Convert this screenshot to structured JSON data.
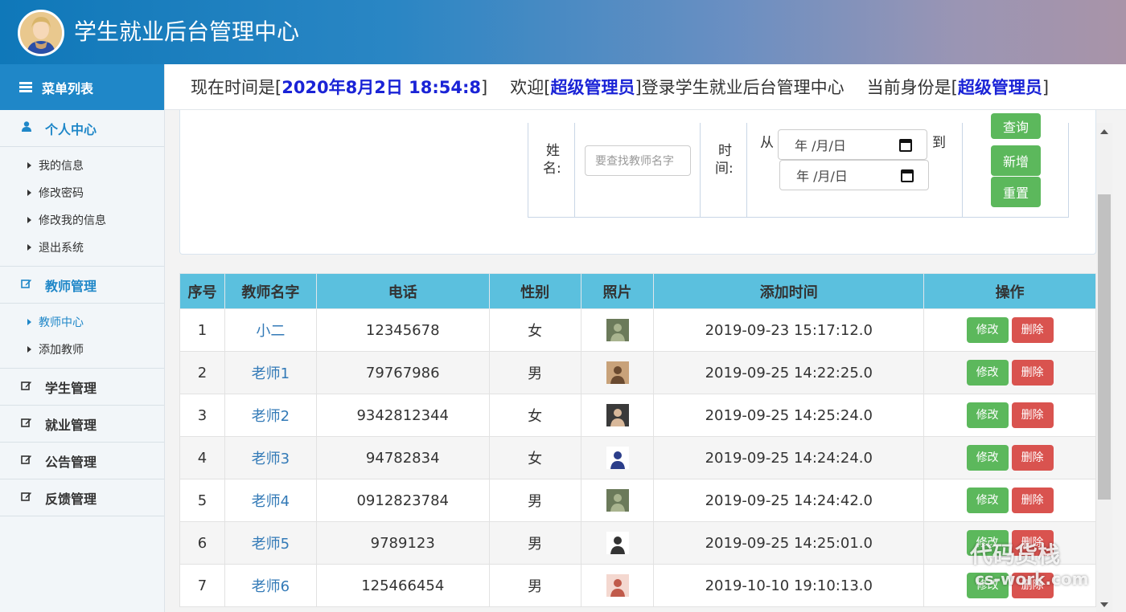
{
  "header": {
    "title": "学生就业后台管理中心"
  },
  "sidebar": {
    "menu_title": "菜单列表",
    "groups": [
      {
        "title": "个人中心",
        "icon": "user-icon",
        "items": [
          "我的信息",
          "修改密码",
          "修改我的信息",
          "退出系统"
        ]
      },
      {
        "title": "教师管理",
        "icon": "edit-icon",
        "items": [
          "教师中心",
          "添加教师"
        ]
      },
      {
        "title": "学生管理",
        "icon": "edit-icon"
      },
      {
        "title": "就业管理",
        "icon": "edit-icon"
      },
      {
        "title": "公告管理",
        "icon": "edit-icon"
      },
      {
        "title": "反馈管理",
        "icon": "edit-icon"
      }
    ]
  },
  "infobar": {
    "time_prefix": "现在时间是[",
    "time_value": "2020年8月2日 18:54:8",
    "time_suffix": "]",
    "welcome_prefix": "欢迎[",
    "welcome_user": "超级管理员",
    "welcome_suffix": "]登录学生就业后台管理中心",
    "role_prefix": "当前身份是[",
    "role_value": "超级管理员",
    "role_suffix": "]"
  },
  "search": {
    "name_label_1": "姓",
    "name_label_2": "名:",
    "name_placeholder": "要查找教师名字",
    "time_label_1": "时",
    "time_label_2": "间:",
    "from_label": "从",
    "to_label": "到",
    "date_placeholder": "年 /月/日",
    "query_button": "查询",
    "add_button": "新增",
    "reset_button": "重置"
  },
  "table": {
    "columns": [
      "序号",
      "教师名字",
      "电话",
      "性别",
      "照片",
      "添加时间",
      "操作"
    ],
    "edit_label": "修改",
    "delete_label": "删除",
    "rows": [
      [
        "1",
        "小二",
        "12345678",
        "女",
        "2019-09-23 15:17:12.0"
      ],
      [
        "2",
        "老师1",
        "79767986",
        "男",
        "2019-09-25 14:22:25.0"
      ],
      [
        "3",
        "老师2",
        "9342812344",
        "女",
        "2019-09-25 14:25:24.0"
      ],
      [
        "4",
        "老师3",
        "94782834",
        "女",
        "2019-09-25 14:24:24.0"
      ],
      [
        "5",
        "老师4",
        "0912823784",
        "男",
        "2019-09-25 14:24:42.0"
      ],
      [
        "6",
        "老师5",
        "9789123",
        "男",
        "2019-09-25 14:25:01.0"
      ],
      [
        "7",
        "老师6",
        "125466454",
        "男",
        "2019-10-10 19:10:13.0"
      ]
    ]
  },
  "watermark": {
    "line1": "代码货栈",
    "line2": "cs-work.com"
  },
  "colors": {
    "primary": "#1f87c8",
    "table_header": "#5bc0de",
    "success": "#5cb85c",
    "danger": "#d9534f",
    "highlight_text": "#1a23d6"
  }
}
